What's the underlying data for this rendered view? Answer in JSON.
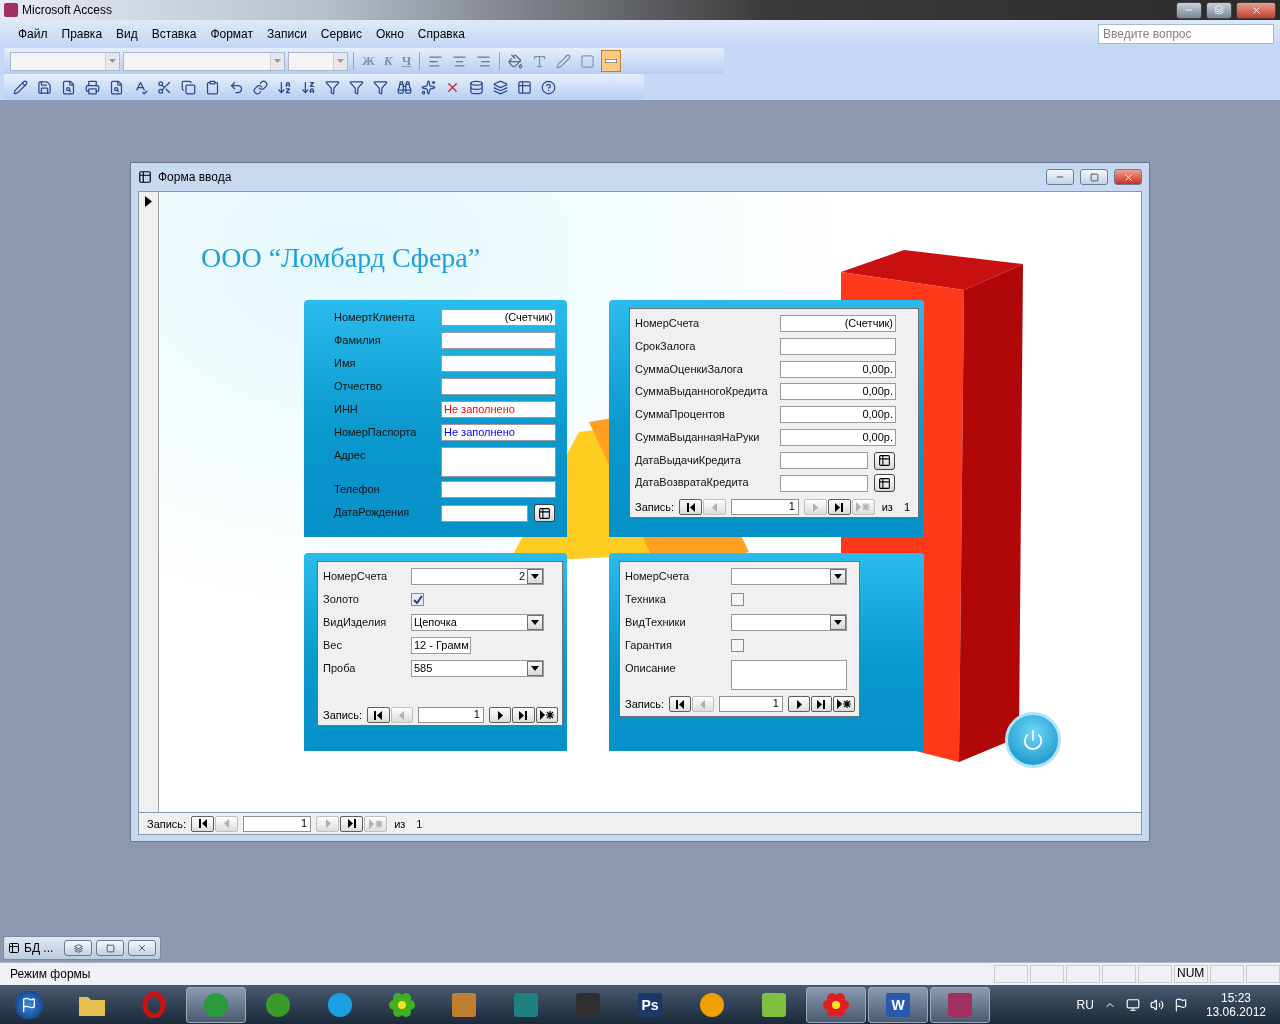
{
  "app": {
    "title": "Microsoft Access"
  },
  "menu": [
    "Файл",
    "Правка",
    "Вид",
    "Вставка",
    "Формат",
    "Записи",
    "Сервис",
    "Окно",
    "Справка"
  ],
  "help": {
    "placeholder": "Введите вопрос"
  },
  "format_buttons": [
    "Ж",
    "К",
    "Ч"
  ],
  "form": {
    "title": "Форма ввода",
    "heading": "ООО “Ломбард Сфера”",
    "client": {
      "fields": [
        {
          "kind": "number",
          "label": "НомертКлиента",
          "value": "(Счетчик)"
        },
        {
          "kind": "text",
          "label": "Фамилия"
        },
        {
          "kind": "text",
          "label": "Имя"
        },
        {
          "kind": "text",
          "label": "Отчество"
        },
        {
          "kind": "text",
          "label": "ИНН",
          "value": "Не заполнено",
          "color": "#ff0000"
        },
        {
          "kind": "text",
          "label": "НомерПаспорта",
          "value": "Не заполнено",
          "color": "#0000ff"
        },
        {
          "kind": "memo",
          "label": "Адрес"
        },
        {
          "kind": "text",
          "label": "Телефон"
        },
        {
          "kind": "date",
          "label": "ДатаРождения"
        }
      ]
    },
    "loan": {
      "fields": [
        {
          "kind": "number",
          "label": "НомерСчета",
          "value": "(Счетчик)"
        },
        {
          "kind": "text",
          "label": "СрокЗалога"
        },
        {
          "kind": "number",
          "label": "СуммаОценкиЗалога",
          "value": "0,00р."
        },
        {
          "kind": "number",
          "label": "СуммаВыданногоКредита",
          "value": "0,00р."
        },
        {
          "kind": "number",
          "label": "СуммаПроцентов",
          "value": "0,00р."
        },
        {
          "kind": "number",
          "label": "СуммаВыданнаяНаРуки",
          "value": "0,00р."
        },
        {
          "kind": "date",
          "label": "ДатаВыдачиКредита"
        },
        {
          "kind": "date",
          "label": "ДатаВозвратаКредита"
        }
      ],
      "nav": {
        "label": "Запись:",
        "current": "1",
        "of": "из",
        "total": "1",
        "buttons": [
          {
            "kind": "first",
            "disabled": false
          },
          {
            "kind": "prev",
            "disabled": true
          },
          {
            "kind": "next",
            "disabled": true
          },
          {
            "kind": "last",
            "disabled": false
          },
          {
            "kind": "new",
            "disabled": true
          }
        ]
      }
    },
    "gold": {
      "fields": [
        {
          "kind": "number_combo",
          "label": "НомерСчета",
          "value": "2"
        },
        {
          "kind": "check",
          "label": "Золото",
          "checked": true
        },
        {
          "kind": "combo",
          "label": "ВидИзделия",
          "value": "Цепочка"
        },
        {
          "kind": "short",
          "label": "Вес",
          "value": "12 - Грамм"
        },
        {
          "kind": "combo",
          "label": "Проба",
          "value": "585"
        }
      ],
      "nav": {
        "label": "Запись:",
        "current": "1",
        "buttons": [
          {
            "kind": "first",
            "disabled": false
          },
          {
            "kind": "prev",
            "disabled": true
          },
          {
            "kind": "next",
            "disabled": false
          },
          {
            "kind": "last",
            "disabled": false
          },
          {
            "kind": "new",
            "disabled": false
          }
        ]
      }
    },
    "tech": {
      "fields": [
        {
          "kind": "combo",
          "label": "НомерСчета"
        },
        {
          "kind": "check",
          "label": "Техника",
          "checked": false
        },
        {
          "kind": "combo",
          "label": "ВидТехники"
        },
        {
          "kind": "check",
          "label": "Гарантия",
          "checked": false
        },
        {
          "kind": "memo",
          "label": "Описание"
        }
      ],
      "nav": {
        "label": "Запись:",
        "current": "1",
        "buttons": [
          {
            "kind": "first",
            "disabled": false
          },
          {
            "kind": "prev",
            "disabled": true
          },
          {
            "kind": "next",
            "disabled": false
          },
          {
            "kind": "last",
            "disabled": false
          },
          {
            "kind": "new",
            "disabled": false
          }
        ]
      }
    },
    "nav": {
      "label": "Запись:",
      "current": "1",
      "of": "из",
      "total": "1",
      "buttons": [
        {
          "kind": "first",
          "disabled": false
        },
        {
          "kind": "prev",
          "disabled": true
        },
        {
          "kind": "next",
          "disabled": true
        },
        {
          "kind": "last",
          "disabled": false
        },
        {
          "kind": "new",
          "disabled": true
        }
      ]
    }
  },
  "minimized": {
    "title": "БД ..."
  },
  "status": {
    "text": "Режим формы",
    "num": "NUM"
  },
  "taskbar": {
    "apps": [
      {
        "kind": "folder",
        "color": "#e8c050",
        "open": false
      },
      {
        "kind": "ring",
        "color": "#d01010",
        "open": false
      },
      {
        "kind": "circle",
        "color": "#2a9a3a",
        "open": true
      },
      {
        "kind": "circle",
        "color": "#3a9a2a",
        "open": false
      },
      {
        "kind": "circle",
        "color": "#1aa0e0",
        "open": false
      },
      {
        "kind": "flower",
        "color": "#40b020",
        "open": false
      },
      {
        "kind": "square",
        "color": "#c08030",
        "open": false
      },
      {
        "kind": "square",
        "color": "#208080",
        "open": false
      },
      {
        "kind": "square",
        "color": "#303030",
        "open": false
      },
      {
        "kind": "text",
        "color": "#1b3a6a",
        "text": "Ps",
        "open": false
      },
      {
        "kind": "circle",
        "color": "#f0a000",
        "open": false
      },
      {
        "kind": "square",
        "color": "#80c040",
        "open": false
      },
      {
        "kind": "flower",
        "color": "#e02020",
        "open": true
      },
      {
        "kind": "text",
        "color": "#2a5ab0",
        "text": "W",
        "open": true
      },
      {
        "kind": "square",
        "color": "#a03060",
        "open": true
      }
    ],
    "language": "RU",
    "time": "15:23",
    "date": "13.06.2012"
  }
}
